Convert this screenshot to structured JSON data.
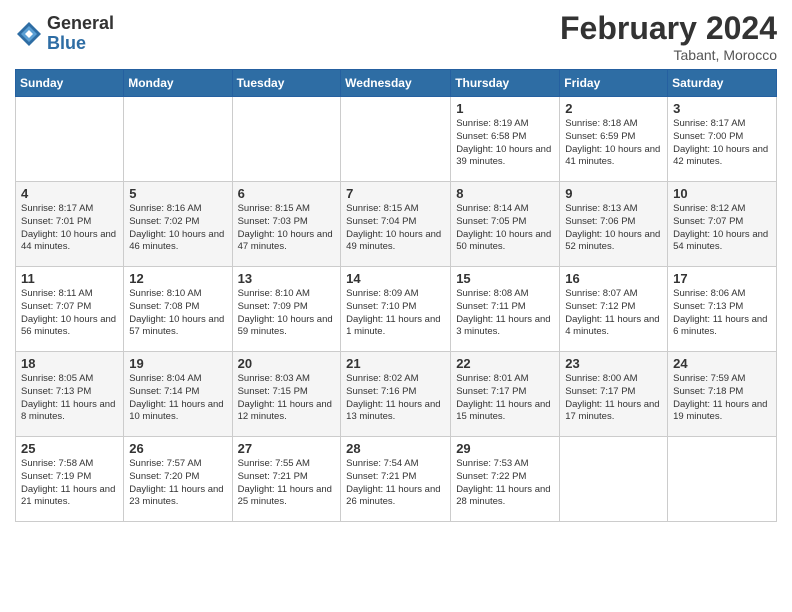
{
  "logo": {
    "general": "General",
    "blue": "Blue"
  },
  "title": "February 2024",
  "location": "Tabant, Morocco",
  "days_header": [
    "Sunday",
    "Monday",
    "Tuesday",
    "Wednesday",
    "Thursday",
    "Friday",
    "Saturday"
  ],
  "weeks": [
    [
      {
        "day": "",
        "info": ""
      },
      {
        "day": "",
        "info": ""
      },
      {
        "day": "",
        "info": ""
      },
      {
        "day": "",
        "info": ""
      },
      {
        "day": "1",
        "info": "Sunrise: 8:19 AM\nSunset: 6:58 PM\nDaylight: 10 hours and 39 minutes."
      },
      {
        "day": "2",
        "info": "Sunrise: 8:18 AM\nSunset: 6:59 PM\nDaylight: 10 hours and 41 minutes."
      },
      {
        "day": "3",
        "info": "Sunrise: 8:17 AM\nSunset: 7:00 PM\nDaylight: 10 hours and 42 minutes."
      }
    ],
    [
      {
        "day": "4",
        "info": "Sunrise: 8:17 AM\nSunset: 7:01 PM\nDaylight: 10 hours and 44 minutes."
      },
      {
        "day": "5",
        "info": "Sunrise: 8:16 AM\nSunset: 7:02 PM\nDaylight: 10 hours and 46 minutes."
      },
      {
        "day": "6",
        "info": "Sunrise: 8:15 AM\nSunset: 7:03 PM\nDaylight: 10 hours and 47 minutes."
      },
      {
        "day": "7",
        "info": "Sunrise: 8:15 AM\nSunset: 7:04 PM\nDaylight: 10 hours and 49 minutes."
      },
      {
        "day": "8",
        "info": "Sunrise: 8:14 AM\nSunset: 7:05 PM\nDaylight: 10 hours and 50 minutes."
      },
      {
        "day": "9",
        "info": "Sunrise: 8:13 AM\nSunset: 7:06 PM\nDaylight: 10 hours and 52 minutes."
      },
      {
        "day": "10",
        "info": "Sunrise: 8:12 AM\nSunset: 7:07 PM\nDaylight: 10 hours and 54 minutes."
      }
    ],
    [
      {
        "day": "11",
        "info": "Sunrise: 8:11 AM\nSunset: 7:07 PM\nDaylight: 10 hours and 56 minutes."
      },
      {
        "day": "12",
        "info": "Sunrise: 8:10 AM\nSunset: 7:08 PM\nDaylight: 10 hours and 57 minutes."
      },
      {
        "day": "13",
        "info": "Sunrise: 8:10 AM\nSunset: 7:09 PM\nDaylight: 10 hours and 59 minutes."
      },
      {
        "day": "14",
        "info": "Sunrise: 8:09 AM\nSunset: 7:10 PM\nDaylight: 11 hours and 1 minute."
      },
      {
        "day": "15",
        "info": "Sunrise: 8:08 AM\nSunset: 7:11 PM\nDaylight: 11 hours and 3 minutes."
      },
      {
        "day": "16",
        "info": "Sunrise: 8:07 AM\nSunset: 7:12 PM\nDaylight: 11 hours and 4 minutes."
      },
      {
        "day": "17",
        "info": "Sunrise: 8:06 AM\nSunset: 7:13 PM\nDaylight: 11 hours and 6 minutes."
      }
    ],
    [
      {
        "day": "18",
        "info": "Sunrise: 8:05 AM\nSunset: 7:13 PM\nDaylight: 11 hours and 8 minutes."
      },
      {
        "day": "19",
        "info": "Sunrise: 8:04 AM\nSunset: 7:14 PM\nDaylight: 11 hours and 10 minutes."
      },
      {
        "day": "20",
        "info": "Sunrise: 8:03 AM\nSunset: 7:15 PM\nDaylight: 11 hours and 12 minutes."
      },
      {
        "day": "21",
        "info": "Sunrise: 8:02 AM\nSunset: 7:16 PM\nDaylight: 11 hours and 13 minutes."
      },
      {
        "day": "22",
        "info": "Sunrise: 8:01 AM\nSunset: 7:17 PM\nDaylight: 11 hours and 15 minutes."
      },
      {
        "day": "23",
        "info": "Sunrise: 8:00 AM\nSunset: 7:17 PM\nDaylight: 11 hours and 17 minutes."
      },
      {
        "day": "24",
        "info": "Sunrise: 7:59 AM\nSunset: 7:18 PM\nDaylight: 11 hours and 19 minutes."
      }
    ],
    [
      {
        "day": "25",
        "info": "Sunrise: 7:58 AM\nSunset: 7:19 PM\nDaylight: 11 hours and 21 minutes."
      },
      {
        "day": "26",
        "info": "Sunrise: 7:57 AM\nSunset: 7:20 PM\nDaylight: 11 hours and 23 minutes."
      },
      {
        "day": "27",
        "info": "Sunrise: 7:55 AM\nSunset: 7:21 PM\nDaylight: 11 hours and 25 minutes."
      },
      {
        "day": "28",
        "info": "Sunrise: 7:54 AM\nSunset: 7:21 PM\nDaylight: 11 hours and 26 minutes."
      },
      {
        "day": "29",
        "info": "Sunrise: 7:53 AM\nSunset: 7:22 PM\nDaylight: 11 hours and 28 minutes."
      },
      {
        "day": "",
        "info": ""
      },
      {
        "day": "",
        "info": ""
      }
    ]
  ]
}
